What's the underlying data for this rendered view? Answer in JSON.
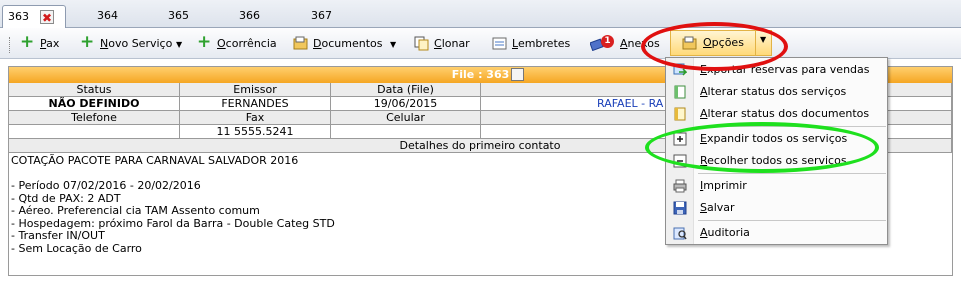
{
  "tabs": [
    {
      "label": "363",
      "active": true
    },
    {
      "label": "364"
    },
    {
      "label": "365"
    },
    {
      "label": "366"
    },
    {
      "label": "367"
    }
  ],
  "toolbar": {
    "pax": "Pax",
    "novo_servico": "Novo Serviço",
    "ocorrencia": "Ocorrência",
    "documentos": "Documentos",
    "clonar": "Clonar",
    "lembretes": "Lembretes",
    "anexos": "Anexos",
    "anexos_badge": "1",
    "opcoes": "Opções"
  },
  "file": {
    "title": "File : 363",
    "headers": [
      "Status",
      "Emissor",
      "Data (File)",
      ""
    ],
    "row1": [
      "NÃO DEFINIDO",
      "FERNANDES",
      "19/06/2015",
      "RAFAEL - RA"
    ],
    "headers2": [
      "Telefone",
      "Fax",
      "Celular",
      ""
    ],
    "row2": [
      "",
      "11 5555.5241",
      "",
      ""
    ],
    "details_header": "Detalhes do primeiro contato",
    "notes": "COTAÇÃO PACOTE PARA CARNAVAL SALVADOR 2016\n\n- Período 07/02/2016 - 20/02/2016\n- Qtd de PAX: 2 ADT\n- Aéreo. Preferencial cia TAM Assento comum\n- Hospedagem: próximo Farol da Barra - Double Categ STD\n- Transfer IN/OUT\n- Sem Locação de Carro"
  },
  "menu": {
    "items": [
      {
        "label": "Exportar reservas para vendas",
        "icon": "export-icon"
      },
      {
        "label": "Alterar status dos serviços",
        "icon": "status-icon"
      },
      {
        "label": "Alterar status dos documentos",
        "icon": "doc-status-icon"
      },
      {
        "label": "Expandir todos os serviços",
        "icon": "expand-icon"
      },
      {
        "label": "Recolher todos os serviços",
        "icon": "collapse-icon"
      },
      {
        "label": "Imprimir",
        "icon": "printer-icon"
      },
      {
        "label": "Salvar",
        "icon": "save-icon"
      },
      {
        "label": "Auditoria",
        "icon": "audit-icon"
      }
    ]
  },
  "colors": {
    "file_header": "#f5a623",
    "annotation_red": "#e01010",
    "annotation_green": "#1ee01e",
    "link_blue": "#1a3fb8"
  }
}
